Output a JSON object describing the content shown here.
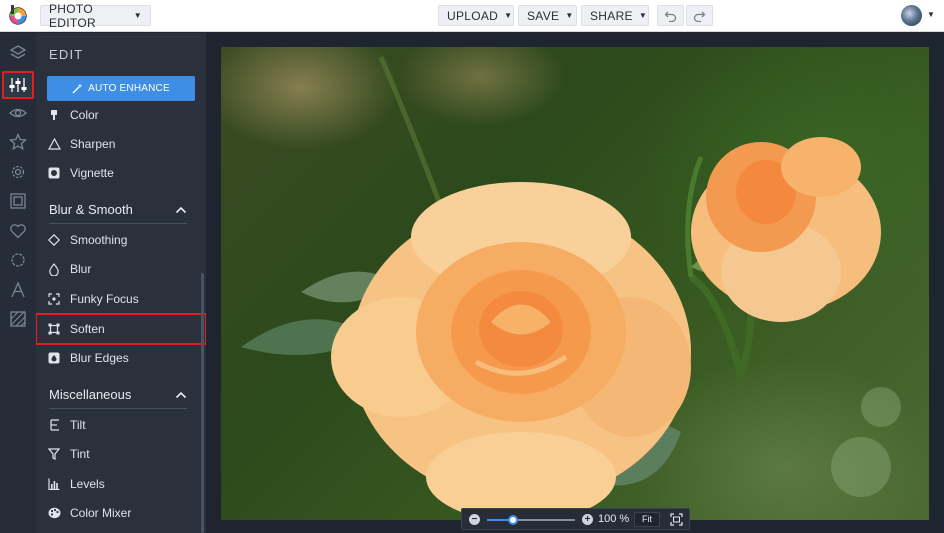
{
  "header": {
    "app_menu_label": "PHOTO EDITOR",
    "upload_label": "UPLOAD",
    "save_label": "SAVE",
    "share_label": "SHARE",
    "undo_icon": "undo-icon",
    "redo_icon": "redo-icon"
  },
  "rail": {
    "icons": [
      "layers-icon",
      "adjustments-icon",
      "eye-icon",
      "star-icon",
      "gear-icon",
      "frame-icon",
      "heart-icon",
      "badge-icon",
      "text-icon",
      "texture-icon"
    ],
    "active": "adjustments-icon"
  },
  "panel": {
    "title": "EDIT",
    "auto_enhance": "AUTO ENHANCE",
    "top_items": [
      "Color",
      "Sharpen",
      "Vignette"
    ],
    "sections": [
      {
        "title": "Blur & Smooth",
        "items": [
          "Smoothing",
          "Blur",
          "Funky Focus",
          "Soften",
          "Blur Edges"
        ]
      },
      {
        "title": "Miscellaneous",
        "items": [
          "Tilt",
          "Tint",
          "Levels",
          "Color Mixer"
        ]
      }
    ],
    "selected": "Soften"
  },
  "zoom": {
    "value": "100 %",
    "fit_label": "Fit",
    "level": 0.3
  },
  "colors": {
    "accent": "#3e8ee6",
    "highlight": "#e02020",
    "panel_bg": "#2a303c",
    "rail_bg": "#262c38"
  }
}
